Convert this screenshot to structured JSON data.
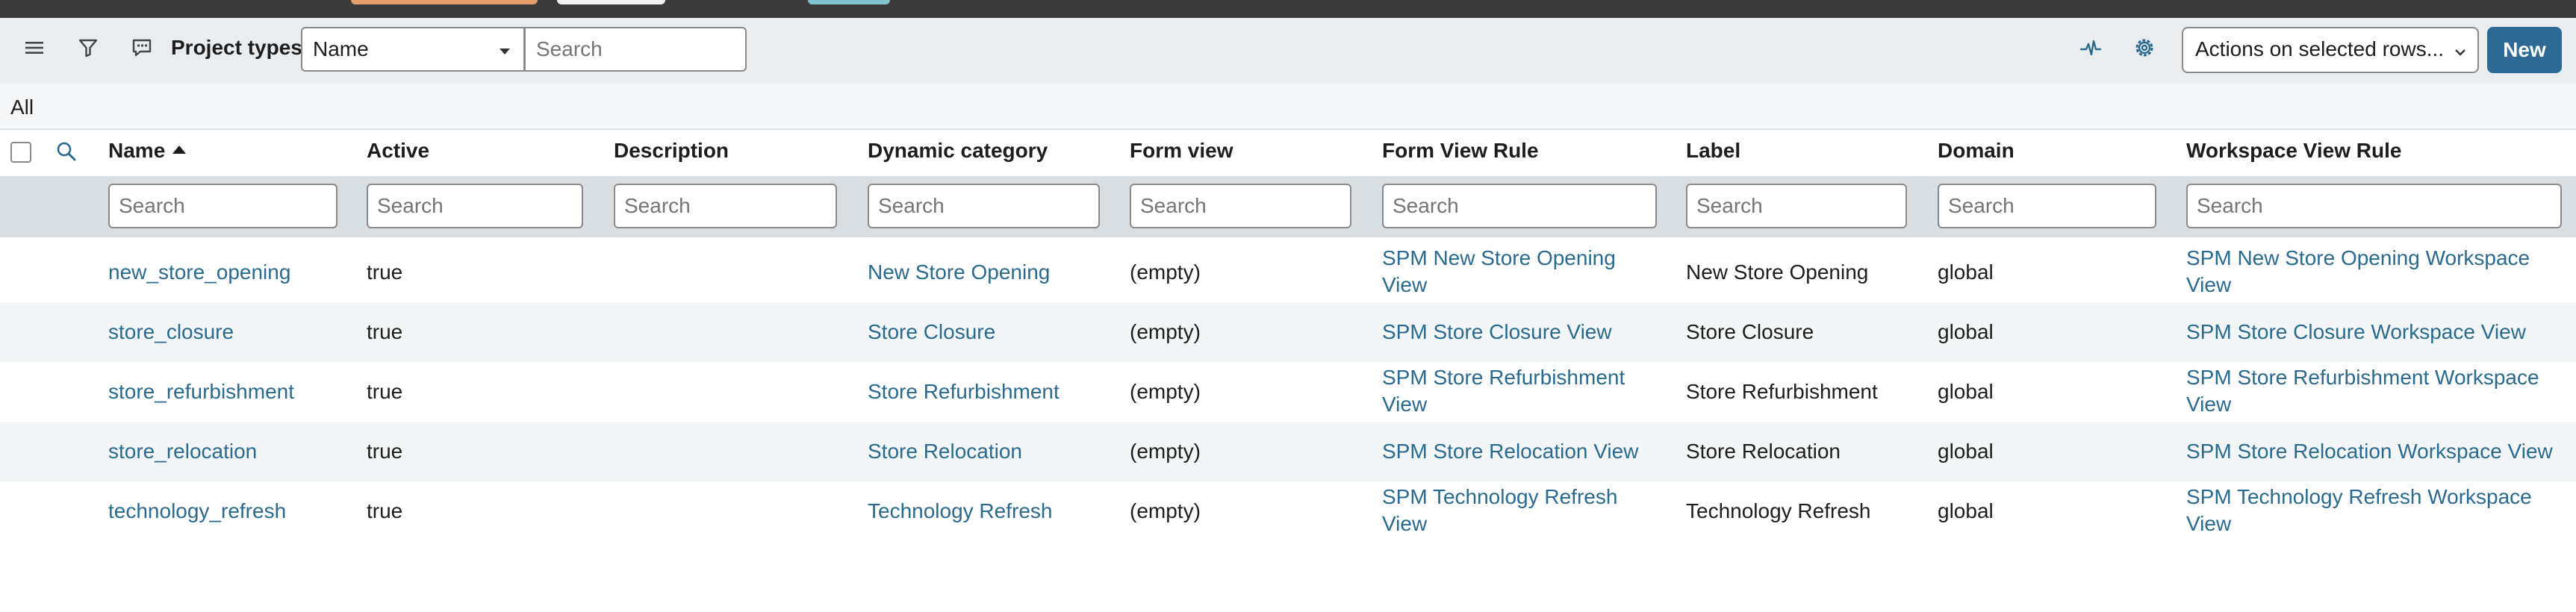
{
  "header": {
    "title": "Project types",
    "field_select": "Name",
    "search_placeholder": "Search",
    "actions_label": "Actions on selected rows...",
    "new_label": "New"
  },
  "breadcrumb": "All",
  "columns": [
    {
      "label": "Name",
      "sorted": "ascending"
    },
    {
      "label": "Active"
    },
    {
      "label": "Description"
    },
    {
      "label": "Dynamic category"
    },
    {
      "label": "Form view"
    },
    {
      "label": "Form View Rule"
    },
    {
      "label": "Label"
    },
    {
      "label": "Domain"
    },
    {
      "label": "Workspace View Rule"
    }
  ],
  "filter_placeholder": "Search",
  "rows": [
    {
      "name": "new_store_opening",
      "active": "true",
      "description": "",
      "dynamic_category": "New Store Opening",
      "form_view": "(empty)",
      "form_view_rule_1": "SPM New Store Opening",
      "form_view_rule_2": "View",
      "label": "New Store Opening",
      "domain": "global",
      "workspace_rule_1": "SPM New Store Opening Workspace",
      "workspace_rule_2": "View"
    },
    {
      "name": "store_closure",
      "active": "true",
      "description": "",
      "dynamic_category": "Store Closure",
      "form_view": "(empty)",
      "form_view_rule_1": "SPM Store Closure View",
      "form_view_rule_2": "",
      "label": "Store Closure",
      "domain": "global",
      "workspace_rule_1": "SPM Store Closure Workspace View",
      "workspace_rule_2": ""
    },
    {
      "name": "store_refurbishment",
      "active": "true",
      "description": "",
      "dynamic_category": "Store Refurbishment",
      "form_view": "(empty)",
      "form_view_rule_1": "SPM Store Refurbishment",
      "form_view_rule_2": "View",
      "label": "Store Refurbishment",
      "domain": "global",
      "workspace_rule_1": "SPM Store Refurbishment Workspace",
      "workspace_rule_2": "View"
    },
    {
      "name": "store_relocation",
      "active": "true",
      "description": "",
      "dynamic_category": "Store Relocation",
      "form_view": "(empty)",
      "form_view_rule_1": "SPM Store Relocation View",
      "form_view_rule_2": "",
      "label": "Store Relocation",
      "domain": "global",
      "workspace_rule_1": "SPM Store Relocation Workspace View",
      "workspace_rule_2": ""
    },
    {
      "name": "technology_refresh",
      "active": "true",
      "description": "",
      "dynamic_category": "Technology Refresh",
      "form_view": "(empty)",
      "form_view_rule_1": "SPM Technology Refresh",
      "form_view_rule_2": "View",
      "label": "Technology Refresh",
      "domain": "global",
      "workspace_rule_1": "SPM Technology Refresh Workspace",
      "workspace_rule_2": "View"
    }
  ],
  "icons": {
    "menu": "hamburger-icon",
    "filter": "funnel-icon",
    "comment": "comment-icon",
    "activity": "pulse-icon",
    "settings": "gear-icon",
    "search": "search-icon"
  },
  "colors": {
    "link": "#2a6a8e",
    "primary_button": "#2c6a95",
    "header_bg": "#e9edf0",
    "filter_row_bg": "#d9dee2"
  }
}
